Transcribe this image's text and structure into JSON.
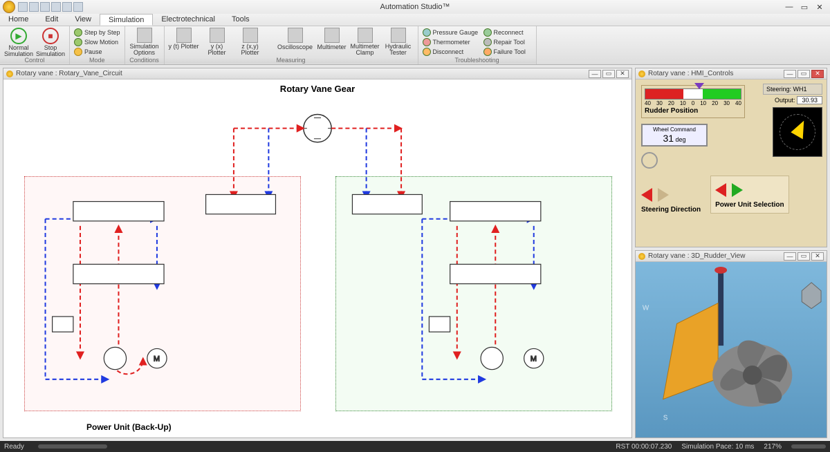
{
  "app": {
    "title": "Automation Studio™"
  },
  "tabs": {
    "home": "Home",
    "edit": "Edit",
    "view": "View",
    "simulation": "Simulation",
    "electro": "Electrotechnical",
    "tools": "Tools"
  },
  "ribbon": {
    "control": {
      "label": "Control",
      "normal": "Normal Simulation",
      "stop": "Stop Simulation"
    },
    "mode": {
      "label": "Mode",
      "step": "Step by Step",
      "slow": "Slow Motion",
      "pause": "Pause"
    },
    "conditions": {
      "label": "Conditions",
      "simopts": "Simulation Options"
    },
    "measuring": {
      "label": "Measuring",
      "yt": "y (t) Plotter",
      "yx": "y (x) Plotter",
      "zxy": "z (x,y) Plotter",
      "oscope": "Oscilloscope",
      "mm": "Multimeter",
      "mmc": "Multimeter Clamp",
      "ht": "Hydraulic Tester"
    },
    "trouble": {
      "label": "Troubleshooting",
      "pg": "Pressure Gauge",
      "th": "Thermometer",
      "dc": "Disconnect",
      "rc": "Reconnect",
      "rt": "Repair Tool",
      "ft": "Failure Tool"
    }
  },
  "panels": {
    "circuit": {
      "title": "Rotary vane : Rotary_Vane_Circuit",
      "heading": "Rotary Vane Gear",
      "backup": "Power Unit (Back-Up)"
    },
    "hmi": {
      "title": "Rotary vane : HMI_Controls",
      "rudder_label": "Rudder Position",
      "ticks": [
        "40",
        "30",
        "20",
        "10",
        "0",
        "10",
        "20",
        "30",
        "40"
      ],
      "wheel_label": "Wheel Command",
      "wheel_value": "31",
      "wheel_unit": "deg",
      "steering_dir": "Steering Direction",
      "power_unit": "Power Unit Selection",
      "steering_name": "Steering: WH1",
      "output_label": "Output:",
      "output_value": "30.93"
    },
    "rudder3d": {
      "title": "Rotary vane : 3D_Rudder_View"
    }
  },
  "status": {
    "ready": "Ready",
    "rst": "RST 00:00:07.230",
    "pace": "Simulation Pace: 10 ms",
    "zoom": "217%"
  }
}
